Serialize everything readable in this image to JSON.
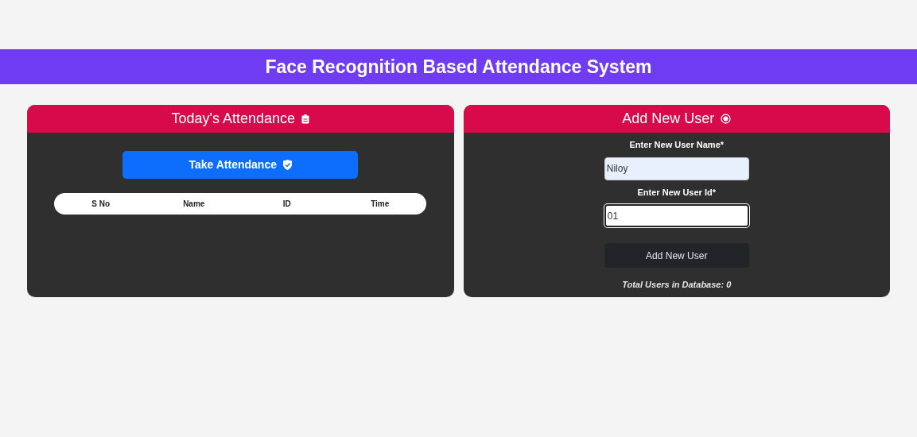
{
  "header": {
    "title": "Face Recognition Based Attendance System"
  },
  "attendance": {
    "title": "Today's Attendance",
    "button": "Take Attendance",
    "columns": [
      "S No",
      "Name",
      "ID",
      "Time"
    ]
  },
  "add_user": {
    "title": "Add New User",
    "fields": [
      {
        "label": "Enter New User Name*",
        "value": "Niloy",
        "autofilled": true,
        "focused": false,
        "kind": "text"
      },
      {
        "label": "Enter New User Id*",
        "value": "01",
        "autofilled": false,
        "focused": true,
        "kind": "number"
      }
    ],
    "button": "Add New User",
    "total": "Total Users in Database: 0"
  }
}
